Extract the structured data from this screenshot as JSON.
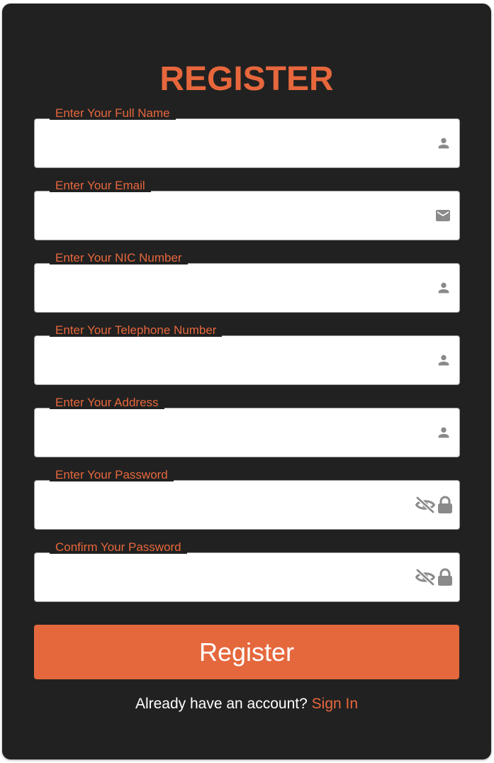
{
  "form": {
    "title": "REGISTER",
    "fields": [
      {
        "label": "Enter Your Full Name",
        "value": "",
        "placeholder": "",
        "icon": "person-icon"
      },
      {
        "label": "Enter Your Email",
        "value": "",
        "placeholder": "",
        "icon": "mail-icon"
      },
      {
        "label": "Enter Your NIC Number",
        "value": "",
        "placeholder": "",
        "icon": "person-icon"
      },
      {
        "label": "Enter Your Telephone Number",
        "value": "",
        "placeholder": "",
        "icon": "person-icon"
      },
      {
        "label": "Enter Your Address",
        "value": "",
        "placeholder": "",
        "icon": "person-icon"
      },
      {
        "label": "Enter Your Password",
        "value": "",
        "placeholder": "",
        "icons": [
          "eye-off-icon",
          "lock-icon"
        ]
      },
      {
        "label": "Confirm Your Password",
        "value": "",
        "placeholder": "",
        "icons": [
          "eye-off-icon",
          "lock-icon"
        ]
      }
    ],
    "submit_label": "Register",
    "footer": {
      "prompt": "Already have an account?",
      "link_label": "Sign In"
    }
  },
  "colors": {
    "accent": "#e7673c",
    "card_background": "#212121",
    "icon": "#8a8a8a",
    "button_text": "#ffffff"
  }
}
